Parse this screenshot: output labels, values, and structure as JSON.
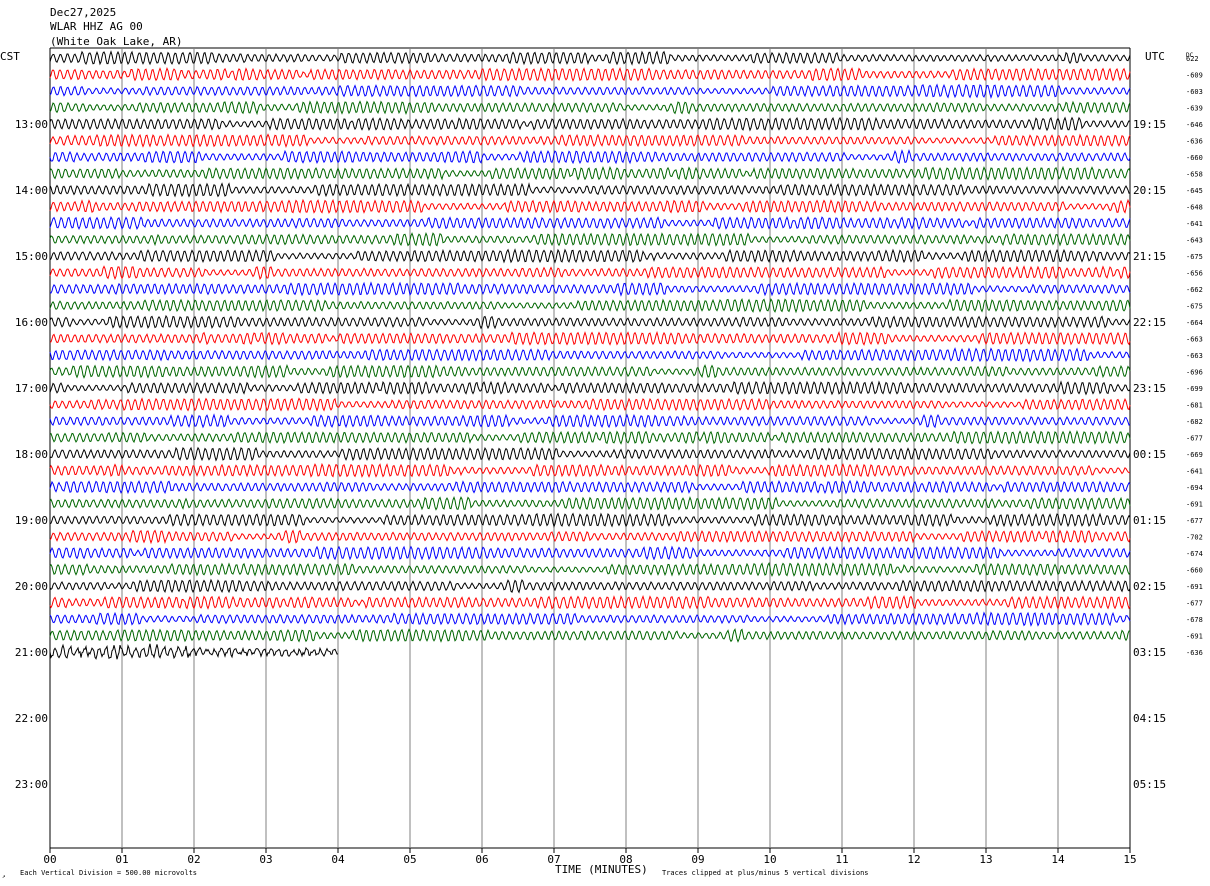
{
  "header": {
    "date": "Dec27,2025",
    "station": "WLAR HHZ AG 00",
    "location": "(White Oak Lake, AR)"
  },
  "left_axis_label": "CST",
  "right_axis_label": "UTC",
  "dc_label": "DC",
  "footer": {
    "scale_note": "Each Vertical Division =  500.00 microvolts",
    "x_axis_title": "TIME (MINUTES)",
    "clip_note": "Traces clipped at plus/minus 5 vertical divisions"
  },
  "colors": {
    "trace_cycle": [
      "#000000",
      "#ff0000",
      "#0000ff",
      "#006600"
    ],
    "grid": "#808080"
  },
  "chart_data": {
    "type": "helicorder",
    "x_range_minutes": [
      0,
      15
    ],
    "x_ticks": [
      "00",
      "01",
      "02",
      "03",
      "04",
      "05",
      "06",
      "07",
      "08",
      "09",
      "10",
      "11",
      "12",
      "13",
      "14",
      "15"
    ],
    "rows_total": 48,
    "rows_per_hour": 4,
    "rows_with_data": 37,
    "last_row_end_minute": 4,
    "left_hour_labels": [
      "13:00",
      "14:00",
      "15:00",
      "16:00",
      "17:00",
      "18:00",
      "19:00",
      "20:00",
      "21:00",
      "22:00",
      "23:00"
    ],
    "right_hour_labels": [
      "19:15",
      "20:15",
      "21:15",
      "22:15",
      "23:15",
      "00:15",
      "01:15",
      "02:15",
      "03:15",
      "04:15",
      "05:15"
    ],
    "first_labeled_row": 4,
    "dc_offsets": [
      "622",
      "-609",
      "-603",
      "-639",
      "-646",
      "-636",
      "-660",
      "-658",
      "-645",
      "-648",
      "-641",
      "-643",
      "-675",
      "-656",
      "-662",
      "-675",
      "-664",
      "-663",
      "-663",
      "-696",
      "-699",
      "-681",
      "-682",
      "-677",
      "-669",
      "-641",
      "-694",
      "-691",
      "-677",
      "-702",
      "-674",
      "-660",
      "-691",
      "-677",
      "-678",
      "-691",
      "-636"
    ]
  }
}
